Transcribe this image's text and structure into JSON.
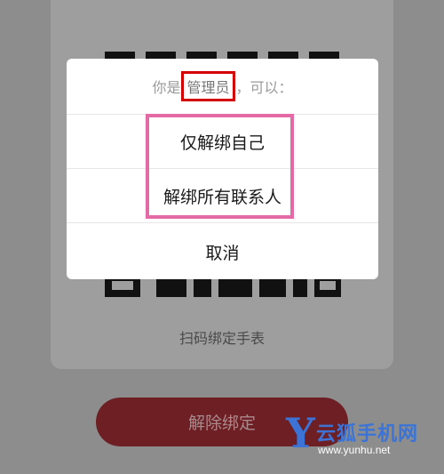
{
  "background": {
    "scan_label": "扫码绑定手表",
    "unbind_button": "解除绑定"
  },
  "dialog": {
    "header_prefix": "你是",
    "role": "管理员",
    "header_suffix": "，可以：",
    "options": [
      "仅解绑自己",
      "解绑所有联系人"
    ],
    "cancel": "取消"
  },
  "watermark": {
    "mark": "Y",
    "name": "云狐手机网",
    "url": "www.yunhu.net"
  },
  "colors": {
    "overlay": "#8d8d8d",
    "unbind_button": "#6d1f24",
    "role_highlight": "#d40000",
    "options_highlight": "#e46aa5",
    "watermark": "#3b74d6"
  }
}
